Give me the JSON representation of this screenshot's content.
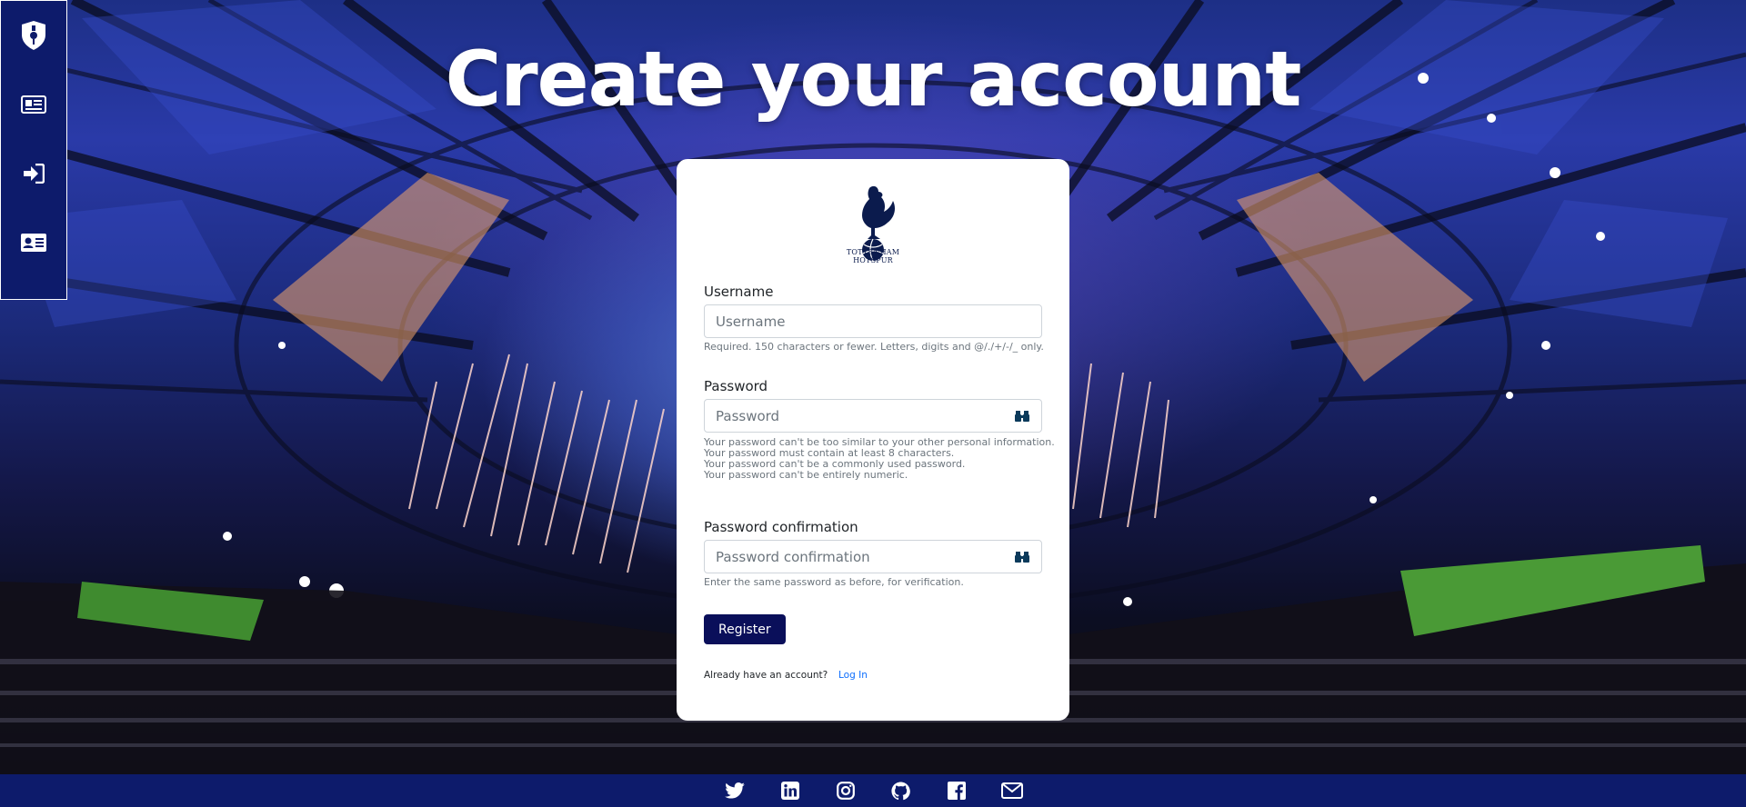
{
  "page": {
    "title": "Create your account"
  },
  "sidebar": {
    "items": [
      {
        "icon": "crest-shield-icon"
      },
      {
        "icon": "newspaper-icon"
      },
      {
        "icon": "sign-in-icon"
      },
      {
        "icon": "id-card-icon"
      }
    ]
  },
  "card": {
    "logo_text_line1": "TOTTENHAM",
    "logo_text_line2": "HOTSPUR",
    "username": {
      "label": "Username",
      "placeholder": "Username",
      "help": "Required. 150 characters or fewer. Letters, digits and @/./+/-/_ only."
    },
    "password": {
      "label": "Password",
      "placeholder": "Password",
      "help": [
        "Your password can't be too similar to your other personal information.",
        "Your password must contain at least 8 characters.",
        "Your password can't be a commonly used password.",
        "Your password can't be entirely numeric."
      ]
    },
    "password_confirmation": {
      "label": "Password confirmation",
      "placeholder": "Password confirmation",
      "help": "Enter the same password as before, for verification."
    },
    "register_label": "Register",
    "already_text": "Already have an account?",
    "login_label": "Log In"
  },
  "footer": {
    "icons": [
      "twitter-icon",
      "linkedin-icon",
      "instagram-icon",
      "github-icon",
      "facebook-icon",
      "envelope-icon"
    ]
  },
  "colors": {
    "nav_bg": "#0d1b6b",
    "register_button": "#0a0f5a",
    "link": "#0d6efd",
    "crest_navy": "#0b1b4d"
  }
}
